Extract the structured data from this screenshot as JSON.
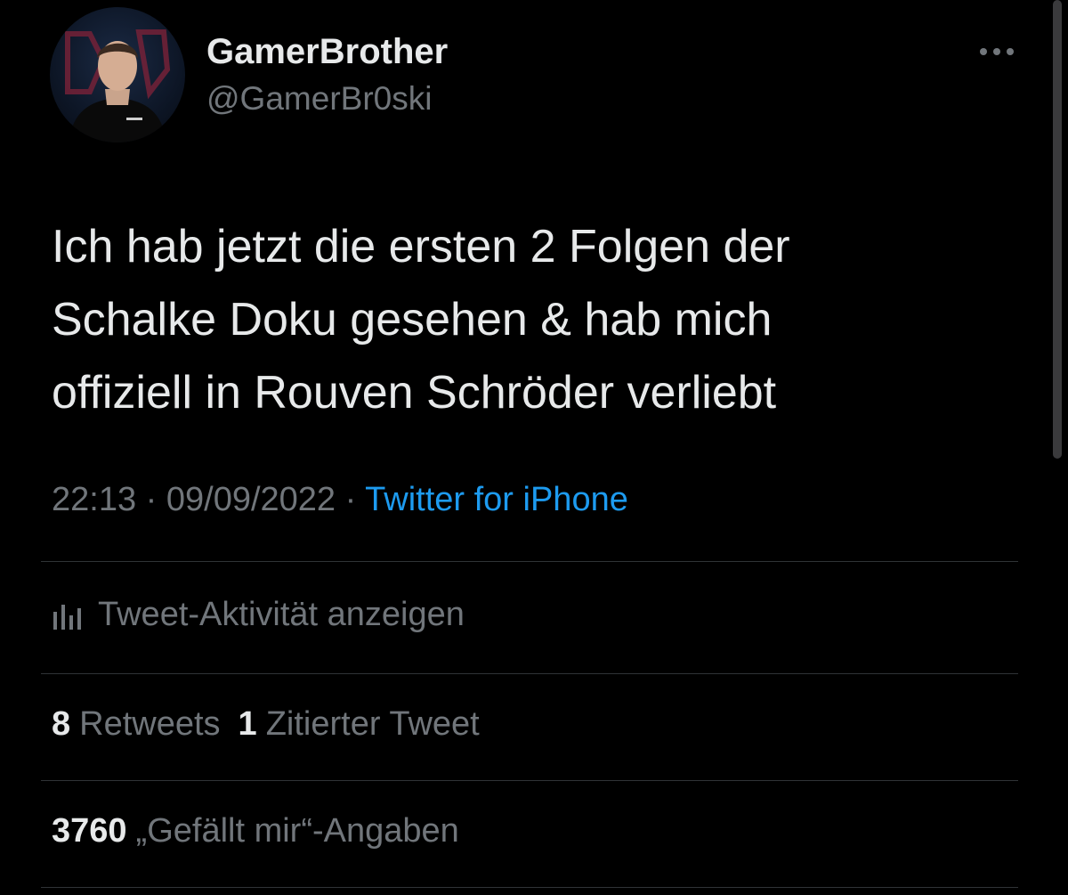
{
  "author": {
    "display_name": "GamerBrother",
    "handle": "@GamerBr0ski",
    "avatar_icon": "profile-photo"
  },
  "more_icon": "more-options-icon",
  "tweet": {
    "lines": [
      "Ich hab jetzt die ersten 2 Folgen der",
      "Schalke Doku gesehen & hab mich",
      "offiziell in Rouven Schröder verliebt"
    ]
  },
  "meta": {
    "time": "22:13",
    "separator": "·",
    "date": "09/09/2022",
    "source": "Twitter for iPhone"
  },
  "activity": {
    "icon": "chart-icon",
    "label": "Tweet-Aktivität anzeigen"
  },
  "stats": {
    "retweets_count": "8",
    "retweets_label": "Retweets",
    "quotes_count": "1",
    "quotes_label": "Zitierter Tweet",
    "likes_count": "3760",
    "likes_label": "„Gefällt mir“-Angaben"
  },
  "colors": {
    "background": "#000000",
    "text_primary": "#e7e9ea",
    "text_secondary": "#71767b",
    "link": "#1d9bf0",
    "divider": "#2f3336"
  }
}
